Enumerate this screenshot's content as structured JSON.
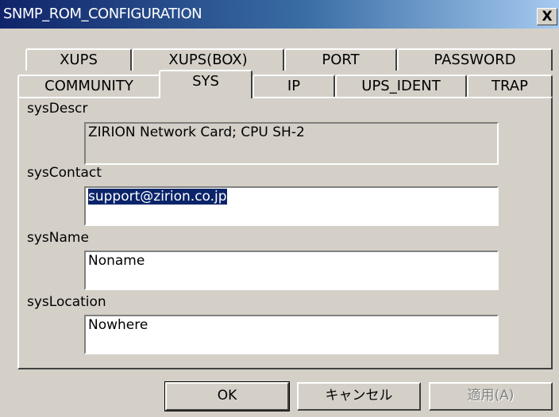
{
  "window": {
    "title": "SNMP_ROM_CONFIGURATION",
    "close_label": "X"
  },
  "tabs": {
    "row1": [
      {
        "label": "XUPS"
      },
      {
        "label": "XUPS(BOX)"
      },
      {
        "label": "PORT"
      },
      {
        "label": "PASSWORD"
      }
    ],
    "row2": [
      {
        "label": "COMMUNITY"
      },
      {
        "label": "SYS",
        "active": true
      },
      {
        "label": "IP"
      },
      {
        "label": "UPS_IDENT"
      },
      {
        "label": "TRAP"
      }
    ]
  },
  "fields": {
    "sysDescr": {
      "label": "sysDescr",
      "value": "ZIRION Network Card; CPU SH-2",
      "editable": false
    },
    "sysContact": {
      "label": "sysContact",
      "value": "support@zirion.co.jp",
      "selected": true
    },
    "sysName": {
      "label": "sysName",
      "value": "Noname"
    },
    "sysLocation": {
      "label": "sysLocation",
      "value": "Nowhere"
    }
  },
  "buttons": {
    "ok": "OK",
    "cancel": "キャンセル",
    "apply": "適用(A)"
  }
}
